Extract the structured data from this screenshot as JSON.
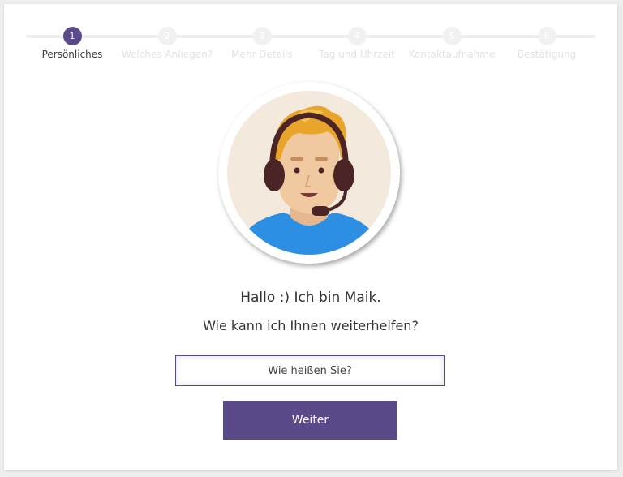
{
  "stepper": {
    "steps": [
      {
        "number": "1",
        "label": "Persönliches",
        "active": true
      },
      {
        "number": "2",
        "label": "Welches Anliegen?",
        "active": false
      },
      {
        "number": "3",
        "label": "Mehr Details",
        "active": false
      },
      {
        "number": "4",
        "label": "Tag und Uhrzeit",
        "active": false
      },
      {
        "number": "5",
        "label": "Kontaktaufnahme",
        "active": false
      },
      {
        "number": "6",
        "label": "Bestätigung",
        "active": false
      }
    ]
  },
  "avatar": {
    "icon": "support-agent-avatar-icon"
  },
  "greeting": {
    "line1": "Hallo :) Ich bin Maik.",
    "line2": "Wie kann ich Ihnen weiterhelfen?"
  },
  "form": {
    "name_placeholder": "Wie heißen Sie?",
    "name_value": "",
    "next_label": "Weiter"
  },
  "colors": {
    "accent": "#5b4a8a",
    "inactive_step": "#f1f1f1",
    "background": "#eeeeee"
  }
}
